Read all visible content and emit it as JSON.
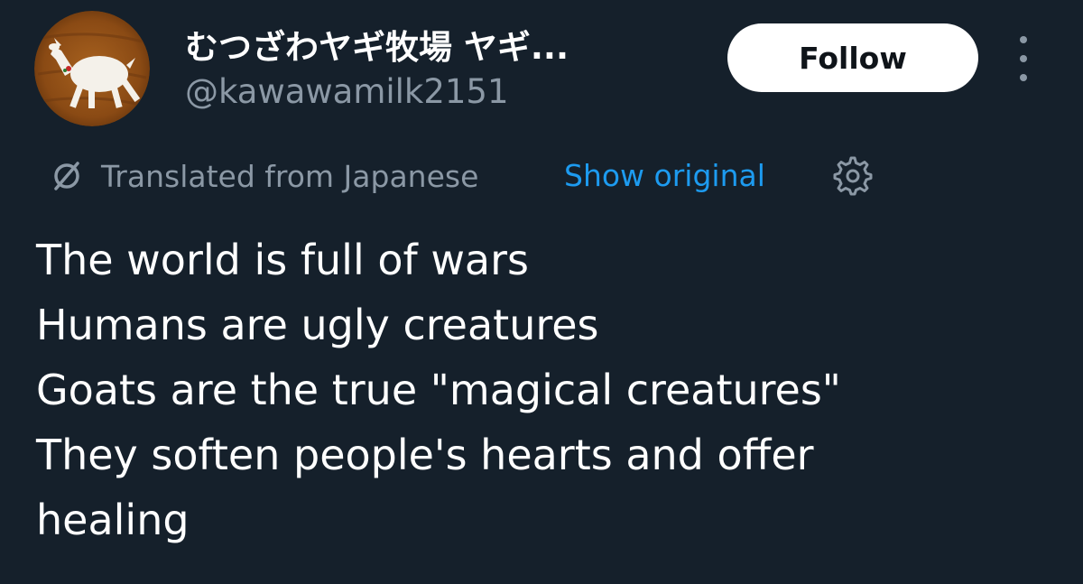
{
  "author": {
    "display_name": "むつざわヤギ牧場 ヤギ...",
    "handle": "@kawawamilk2151",
    "avatar_icon": "goat-avatar-icon"
  },
  "actions": {
    "follow_label": "Follow",
    "more_icon": "more-options-icon"
  },
  "translation": {
    "label": "Translated from Japanese",
    "show_original_label": "Show original",
    "translate_icon": "translate-icon",
    "settings_icon": "gear-icon"
  },
  "tweet": {
    "lines": [
      "The world is full of wars",
      "Humans are ugly creatures",
      "Goats are the true \"magical creatures\"",
      "They soften people's hearts and offer",
      "healing"
    ]
  },
  "colors": {
    "background": "#15202b",
    "text_primary": "#ffffff",
    "text_secondary": "#8b98a5",
    "link": "#1d9bf0",
    "follow_bg": "#ffffff"
  }
}
